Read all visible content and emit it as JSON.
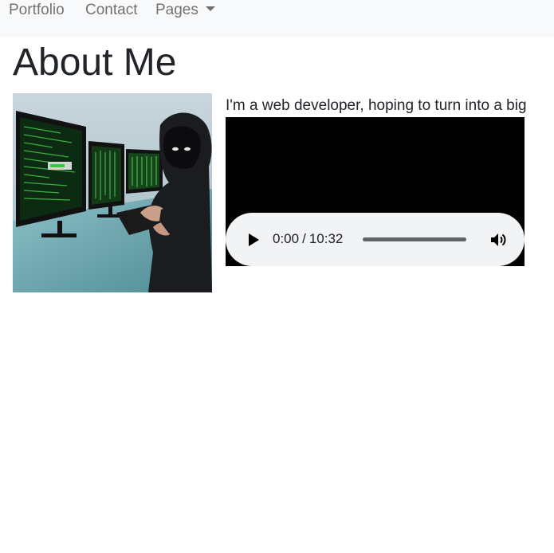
{
  "nav": {
    "portfolio_label": "Portfolio",
    "contact_label": "Contact",
    "pages_label": "Pages"
  },
  "main": {
    "title": "About Me",
    "intro_text": "I'm a web developer, hoping to turn into a big",
    "photo_icon": "hacker-photo"
  },
  "audio": {
    "current_time": "0:00",
    "separator": "/",
    "duration": "10:32",
    "progress_fraction": 0,
    "play_icon": "play-icon",
    "volume_icon": "volume-icon"
  },
  "colors": {
    "navbar_bg": "#f8f9fa",
    "nav_text": "#8c8d8e",
    "player_bg": "#f1f3f4",
    "video_bg": "#000000"
  }
}
